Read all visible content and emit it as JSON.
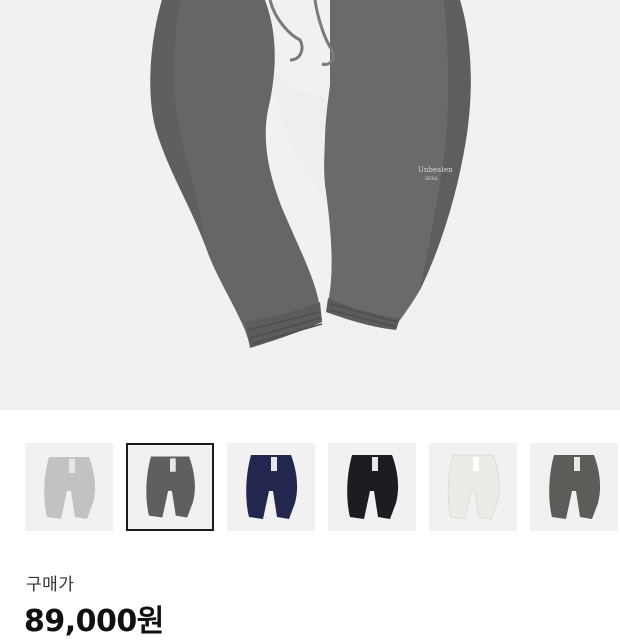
{
  "product": {
    "main_image_icon": "grey-sweatpants-image",
    "logo_text": "Unbeaten",
    "logo_subtext": "SEOUL",
    "main_color": "#646464"
  },
  "thumbnails": [
    {
      "color_name": "light-grey",
      "color": "#c2c2c2",
      "selected": false
    },
    {
      "color_name": "charcoal",
      "color": "#5f5f5f",
      "selected": true
    },
    {
      "color_name": "navy",
      "color": "#23264d",
      "selected": false
    },
    {
      "color_name": "black",
      "color": "#1c1d22",
      "selected": false
    },
    {
      "color_name": "cream",
      "color": "#ecebe6",
      "selected": false
    },
    {
      "color_name": "dark-olive-grey",
      "color": "#5b5d59",
      "selected": false
    }
  ],
  "price": {
    "label": "구매가",
    "value": "89,000원"
  }
}
